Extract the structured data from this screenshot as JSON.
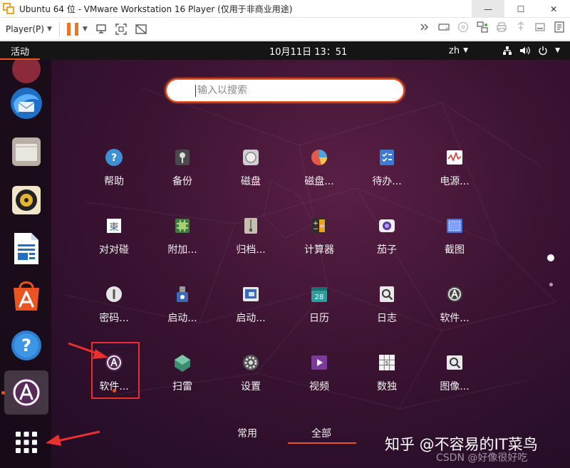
{
  "window": {
    "title": "Ubuntu 64 位 - VMware Workstation 16 Player (仅用于非商业用途)",
    "minimize_glyph": "—",
    "maximize_glyph": "☐",
    "close_glyph": "✕"
  },
  "toolbar": {
    "player_menu_label": "Player(P)",
    "icons": [
      "pause-icon",
      "send-ctrl-alt-del-icon",
      "fullscreen-icon",
      "unity-icon"
    ],
    "right_icons": [
      "more-icon",
      "hdd-icon",
      "cd-icon",
      "network-icon",
      "printer-icon",
      "usb-icon",
      "sound-icon",
      "message-icon"
    ]
  },
  "topbar": {
    "activities": "活动",
    "clock": "10月11日  13：51",
    "lang": "zh"
  },
  "search": {
    "placeholder": "输入以搜索"
  },
  "dock": {
    "items": [
      "thunderbird-icon",
      "files-icon",
      "rhythmbox-icon",
      "writer-icon",
      "software-center-icon",
      "help-icon",
      "software-updater-icon",
      "show-apps-icon"
    ]
  },
  "apps": [
    {
      "label": "帮助",
      "icon": "help-icon",
      "color": "#3d8fd6"
    },
    {
      "label": "备份",
      "icon": "backup-icon",
      "color": "#4a4a4a"
    },
    {
      "label": "磁盘",
      "icon": "disks-icon",
      "color": "#dddddd"
    },
    {
      "label": "磁盘...",
      "icon": "disk-usage-icon",
      "color": "#e35b45"
    },
    {
      "label": "待办...",
      "icon": "todo-icon",
      "color": "#3a7bd5"
    },
    {
      "label": "电源...",
      "icon": "power-stats-icon",
      "color": "#ffffff"
    },
    {
      "label": "对对碰",
      "icon": "swell-foop-icon",
      "color": "#ffffff"
    },
    {
      "label": "附加...",
      "icon": "additional-drivers-icon",
      "color": "#3f7d3a"
    },
    {
      "label": "归档...",
      "icon": "archive-manager-icon",
      "color": "#c9bfae"
    },
    {
      "label": "计算器",
      "icon": "calculator-icon",
      "color": "#2e2e2e"
    },
    {
      "label": "茄子",
      "icon": "cheese-icon",
      "color": "#eeeeee"
    },
    {
      "label": "截图",
      "icon": "screenshot-icon",
      "color": "#4a6fd8"
    },
    {
      "label": "密码...",
      "icon": "passwords-icon",
      "color": "#e6e6e6"
    },
    {
      "label": "启动...",
      "icon": "startup-disk-icon",
      "color": "#3a6ab8"
    },
    {
      "label": "启动...",
      "icon": "startup-apps-icon",
      "color": "#e8e8e8"
    },
    {
      "label": "日历",
      "icon": "calendar-icon",
      "color": "#2f9d9d"
    },
    {
      "label": "日志",
      "icon": "logs-icon",
      "color": "#e8e8e8"
    },
    {
      "label": "软件...",
      "icon": "software-properties-icon",
      "color": "#444444"
    },
    {
      "label": "软件...",
      "icon": "software-updater-icon",
      "color": "#5a2a5a"
    },
    {
      "label": "扫雷",
      "icon": "mines-icon",
      "color": "#3e8c6f"
    },
    {
      "label": "设置",
      "icon": "settings-icon",
      "color": "#555555"
    },
    {
      "label": "视频",
      "icon": "videos-icon",
      "color": "#7a3a9a"
    },
    {
      "label": "数独",
      "icon": "sudoku-icon",
      "color": "#f2f2f2"
    },
    {
      "label": "图像...",
      "icon": "image-viewer-icon",
      "color": "#e8e8e8"
    }
  ],
  "tabs": {
    "frequent": "常用",
    "all": "全部"
  },
  "watermark": {
    "main": "知乎 @不容易的IT菜鸟",
    "csdn": "CSDN @好像很好吃"
  },
  "colors": {
    "accent": "#e95420",
    "annotation_red": "#e8312f"
  }
}
